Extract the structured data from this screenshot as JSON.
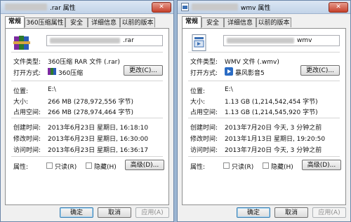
{
  "dialogs": [
    {
      "title_suffix": ".rar 属性",
      "tabs": [
        "常规",
        "360压缩属性",
        "安全",
        "详细信息",
        "以前的版本"
      ],
      "filename_suffix": ".rar",
      "fields": {
        "type_label": "文件类型:",
        "type_value": "360压缩 RAR 文件 (.rar)",
        "open_label": "打开方式:",
        "open_value": "360压缩",
        "change_button": "更改(C)...",
        "location_label": "位置:",
        "location_value": "E:\\",
        "size_label": "大小:",
        "size_value": "266 MB (278,972,556 字节)",
        "disk_label": "占用空间:",
        "disk_value": "266 MB (278,974,464 字节)",
        "created_label": "创建时间:",
        "created_value": "2013年6月23日 星期日, 16:18:10",
        "modified_label": "修改时间:",
        "modified_value": "2013年6月23日 星期日, 16:30:00",
        "accessed_label": "访问时间:",
        "accessed_value": "2013年6月23日 星期日, 16:36:17",
        "attr_label": "属性:",
        "readonly": "只读(R)",
        "hidden": "隐藏(H)",
        "advanced_button": "高级(D)..."
      },
      "buttons": {
        "ok": "确定",
        "cancel": "取消",
        "apply": "应用(A)"
      }
    },
    {
      "title_suffix": "wmv 属性",
      "tabs": [
        "常规",
        "安全",
        "详细信息",
        "以前的版本"
      ],
      "filename_suffix": "wmv",
      "fields": {
        "type_label": "文件类型:",
        "type_value": "WMV 文件 (.wmv)",
        "open_label": "打开方式:",
        "open_value": "暴风影音5",
        "change_button": "更改(C)...",
        "location_label": "位置:",
        "location_value": "E:\\",
        "size_label": "大小:",
        "size_value": "1.13 GB (1,214,542,454 字节)",
        "disk_label": "占用空间:",
        "disk_value": "1.13 GB (1,214,545,920 字节)",
        "created_label": "创建时间:",
        "created_value": "2013年7月20日 今天, 3 分钟之前",
        "modified_label": "修改时间:",
        "modified_value": "2013年1月13日 星期日, 19:20:50",
        "accessed_label": "访问时间:",
        "accessed_value": "2013年7月20日 今天, 3 分钟之前",
        "attr_label": "属性:",
        "readonly": "只读(R)",
        "hidden": "隐藏(H)",
        "advanced_button": "高级(D)..."
      },
      "buttons": {
        "ok": "确定",
        "cancel": "取消",
        "apply": "应用(A)"
      }
    }
  ],
  "colors": {
    "accent": "#3c7fb1",
    "titlebar": "#c2d3e8",
    "close": "#c6402b"
  }
}
